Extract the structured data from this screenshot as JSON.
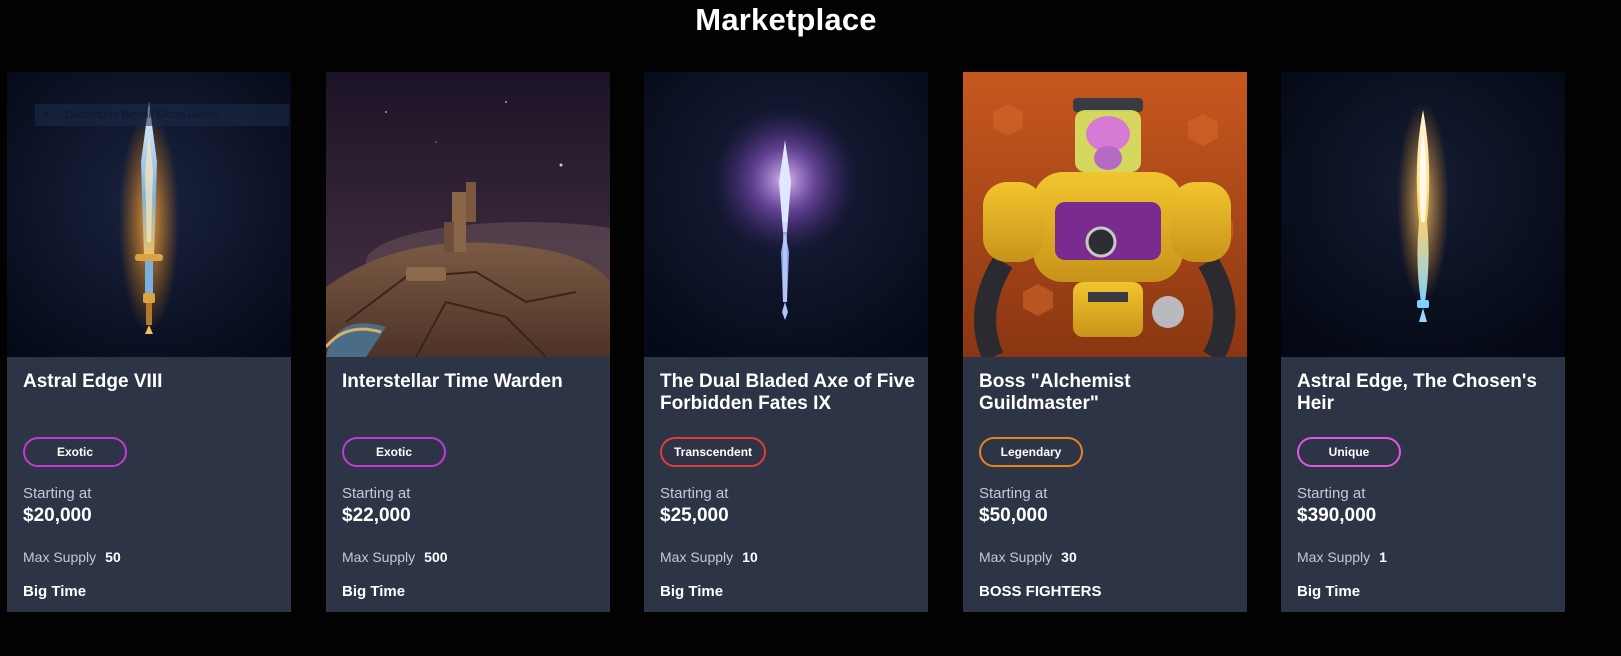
{
  "page": {
    "title": "Marketplace"
  },
  "overlay": {
    "close_glyph": "×",
    "text": "Dikdörtgen Biçimli Ekran Alıntısı"
  },
  "labels": {
    "starting_at": "Starting at",
    "max_supply": "Max Supply"
  },
  "cards": [
    {
      "title": "Astral Edge VIII",
      "rarity": "Exotic",
      "rarity_color": "#c13ad8",
      "price": "$20,000",
      "max_supply": "50",
      "game": "Big Time",
      "image": "golden-sword-art"
    },
    {
      "title": "Interstellar Time Warden",
      "rarity": "Exotic",
      "rarity_color": "#c13ad8",
      "price": "$22,000",
      "max_supply": "500",
      "game": "Big Time",
      "image": "desert-planet-art"
    },
    {
      "title": "The Dual Bladed Axe of Five Forbidden Fates IX",
      "rarity": "Transcendent",
      "rarity_color": "#e23b3b",
      "price": "$25,000",
      "max_supply": "10",
      "game": "Big Time",
      "image": "glowing-spear-art"
    },
    {
      "title": "Boss \"Alchemist Guildmaster\"",
      "rarity": "Legendary",
      "rarity_color": "#e8821e",
      "price": "$50,000",
      "max_supply": "30",
      "game": "BOSS FIGHTERS",
      "image": "alchemist-robot-art"
    },
    {
      "title": "Astral Edge, The Chosen's Heir",
      "rarity": "Unique",
      "rarity_color": "#e455e6",
      "price": "$390,000",
      "max_supply": "1",
      "game": "Big Time",
      "image": "flaming-blade-art"
    }
  ]
}
